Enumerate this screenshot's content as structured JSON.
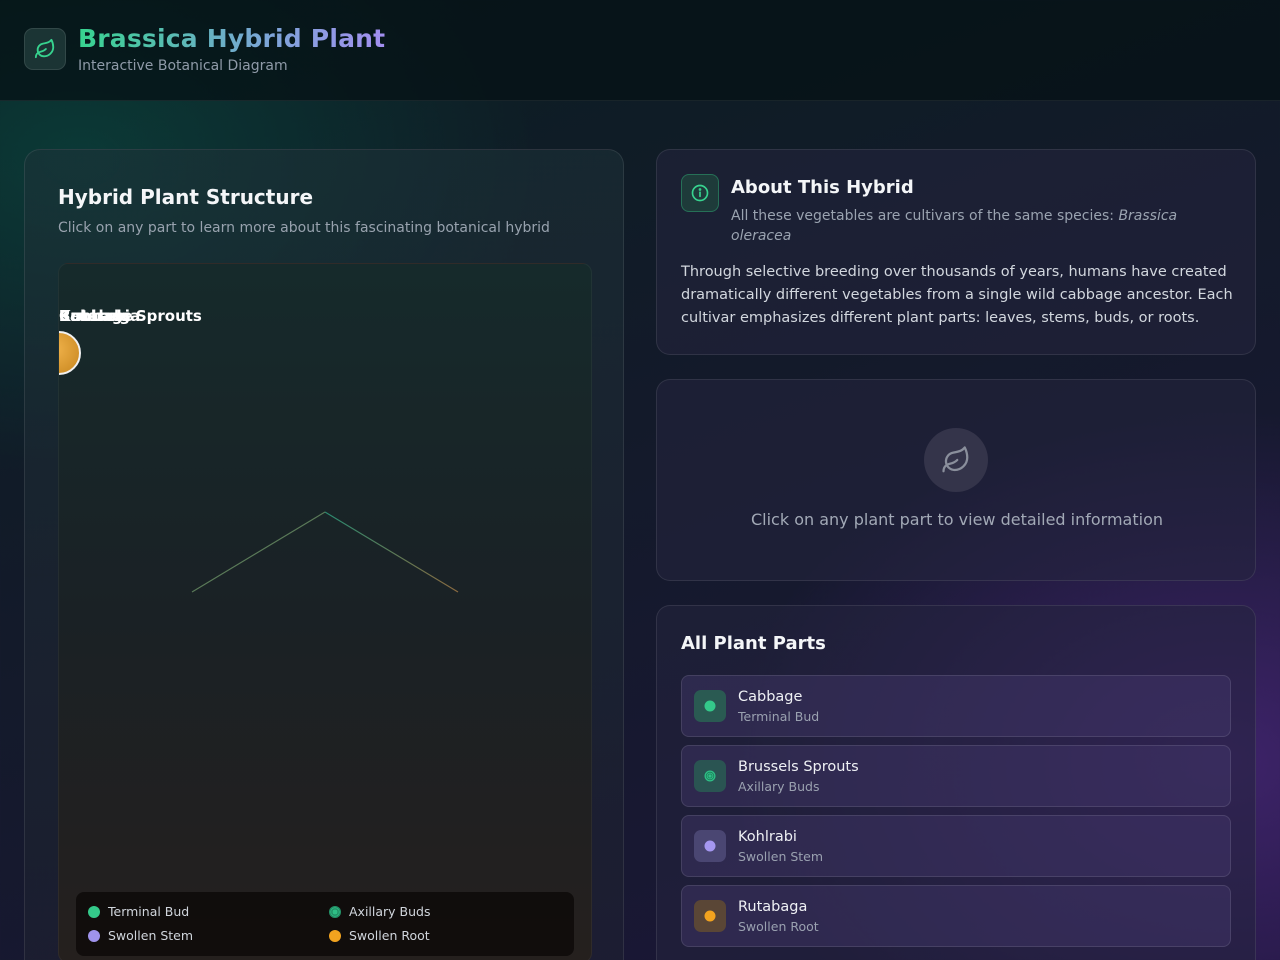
{
  "header": {
    "title": "Brassica Hybrid Plant",
    "subtitle": "Interactive Botanical Diagram"
  },
  "diagram_panel": {
    "title": "Hybrid Plant Structure",
    "subtitle": "Click on any part to learn more about this fascinating botanical hybrid",
    "overlapping_labels": [
      "Cabbage",
      "Brussels Sprouts",
      "Kohlrabi",
      "Rutabaga"
    ],
    "legend": [
      {
        "label": "Terminal Bud",
        "color": "#34c98a"
      },
      {
        "label": "Axillary Buds",
        "color": "#2fbf86"
      },
      {
        "label": "Swollen Stem",
        "color": "#9f93ec"
      },
      {
        "label": "Swollen Root",
        "color": "#f2a31f"
      }
    ]
  },
  "about": {
    "title": "About This Hybrid",
    "subtitle_prefix": "All these vegetables are cultivars of the same species: ",
    "species": "Brassica oleracea",
    "body": "Through selective breeding over thousands of years, humans have created dramatically different vegetables from a single wild cabbage ancestor. Each cultivar emphasizes different plant parts: leaves, stems, buds, or roots."
  },
  "detail": {
    "placeholder": "Click on any plant part to view detailed information"
  },
  "parts": {
    "title": "All Plant Parts",
    "items": [
      {
        "name": "Cabbage",
        "type": "Terminal Bud",
        "color": "#34c98a",
        "icon_bg": "#2a5a52"
      },
      {
        "name": "Brussels Sprouts",
        "type": "Axillary Buds",
        "color": "#2fbf86",
        "icon_bg": "#2a5452"
      },
      {
        "name": "Kohlrabi",
        "type": "Swollen Stem",
        "color": "#a597f0",
        "icon_bg": "#4a4672"
      },
      {
        "name": "Rutabaga",
        "type": "Swollen Root",
        "color": "#f2a31f",
        "icon_bg": "#5a4636"
      }
    ]
  },
  "colors": {
    "accent_green": "#37d38f",
    "accent_purple": "#a38ff0"
  }
}
